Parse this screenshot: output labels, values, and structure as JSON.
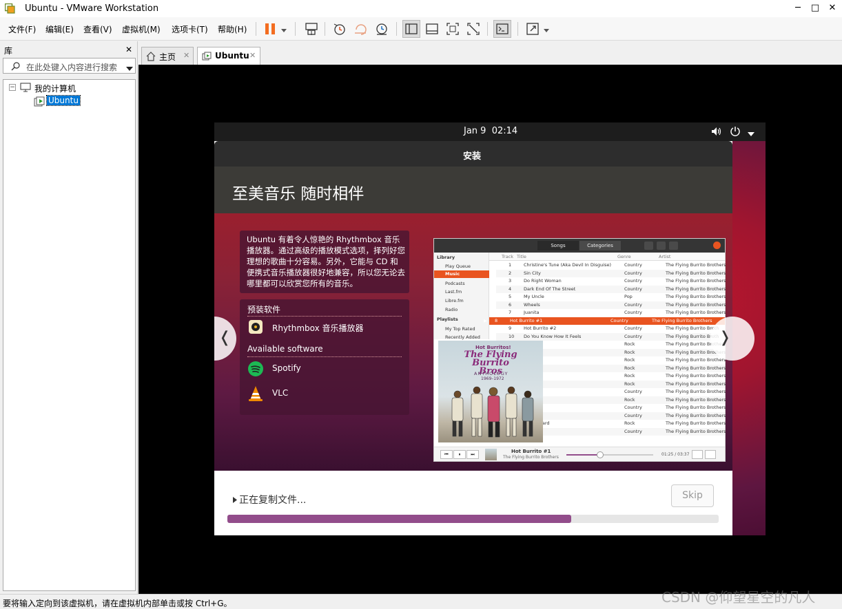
{
  "window": {
    "title": "Ubuntu - VMware Workstation",
    "minimize": "─",
    "maximize": "□",
    "close": "✕"
  },
  "menu": [
    "文件(F)",
    "编辑(E)",
    "查看(V)",
    "虚拟机(M)",
    "选项卡(T)",
    "帮助(H)"
  ],
  "library": {
    "title": "库",
    "close": "✕",
    "search_placeholder": "在此处键入内容进行搜索",
    "tree_root": "我的计算机",
    "tree_item": "Ubuntu",
    "expander": "−"
  },
  "tabs": [
    {
      "label": "主页",
      "close": "✕"
    },
    {
      "label": "Ubuntu",
      "close": "✕"
    }
  ],
  "ubuntu": {
    "clock_date": "Jan 9",
    "clock_time": "02:14",
    "installer_title": "安装",
    "headline": "至美音乐 随时相伴",
    "description": "Ubuntu 有着令人惊艳的 Rhythmbox 音乐播放器。通过高级的播放模式选项，择列好您理想的歌曲十分容易。另外，它能与 CD 和便携式音乐播放器很好地兼容，所以您无论去哪里都可以欣赏您所有的音乐。",
    "preinstalled_title": "预装软件",
    "preinstalled": [
      "Rhythmbox 音乐播放器"
    ],
    "available_title": "Available software",
    "available": [
      "Spotify",
      "VLC"
    ],
    "prev": "❬",
    "next": "❭",
    "progress_text": "正在复制文件...",
    "progress_fraction": 0.7,
    "skip": "Skip",
    "colors": {
      "accent": "#e95420",
      "progress": "#924d8b",
      "panel": "#1d1d1d"
    }
  },
  "rhythmbox": {
    "tab_songs": "Songs",
    "tab_categories": "Categories",
    "sidebar_library": "Library",
    "sidebar_items": [
      "Play Queue",
      "Music",
      "Podcasts",
      "Last.fm",
      "Libre.fm",
      "Radio"
    ],
    "sidebar_playlists": "Playlists",
    "playlist_items": [
      "My Top Rated",
      "Recently Added"
    ],
    "columns": [
      "Track",
      "Title",
      "Genre",
      "Artist"
    ],
    "rows": [
      {
        "n": "1",
        "title": "Christine's Tune (Aka Devil In Disguise)",
        "genre": "Country",
        "artist": "The Flying Burrito Brothers"
      },
      {
        "n": "2",
        "title": "Sin City",
        "genre": "Country",
        "artist": "The Flying Burrito Brothers"
      },
      {
        "n": "3",
        "title": "Do Right Woman",
        "genre": "Country",
        "artist": "The Flying Burrito Brothers"
      },
      {
        "n": "4",
        "title": "Dark End Of The Street",
        "genre": "Country",
        "artist": "The Flying Burrito Brothers"
      },
      {
        "n": "5",
        "title": "My Uncle",
        "genre": "Pop",
        "artist": "The Flying Burrito Brothers"
      },
      {
        "n": "6",
        "title": "Wheels",
        "genre": "Country",
        "artist": "The Flying Burrito Brothers"
      },
      {
        "n": "7",
        "title": "Juanita",
        "genre": "Country",
        "artist": "The Flying Burrito Brothers"
      },
      {
        "n": "8",
        "title": "Hot Burrito #1",
        "genre": "Country",
        "artist": "The Flying Burrito Brothers"
      },
      {
        "n": "9",
        "title": "Hot Burrito #2",
        "genre": "Country",
        "artist": "The Flying Burrito Broth"
      },
      {
        "n": "10",
        "title": "Do You Know How It Feels",
        "genre": "Country",
        "artist": "The Flying Burrito Broth"
      },
      {
        "n": "",
        "title": "ong",
        "genre": "Rock",
        "artist": "The Flying Burrito Brothers"
      },
      {
        "n": "",
        "title": "",
        "genre": "Rock",
        "artist": "The Flying Burrito Brothers"
      },
      {
        "n": "",
        "title": "",
        "genre": "Rock",
        "artist": "The Flying Burrito Brothers"
      },
      {
        "n": "",
        "title": "n Queen",
        "genre": "Rock",
        "artist": "The Flying Burrito Brothers"
      },
      {
        "n": "",
        "title": "Go",
        "genre": "Rock",
        "artist": "The Flying Burrito Brothers"
      },
      {
        "n": "",
        "title": "Fog",
        "genre": "Rock",
        "artist": "The Flying Burrito Brothers"
      },
      {
        "n": "",
        "title": "ng",
        "genre": "Country",
        "artist": "The Flying Burrito Brothers"
      },
      {
        "n": "",
        "title": "",
        "genre": "Rock",
        "artist": "The Flying Burrito Brothers"
      },
      {
        "n": "",
        "title": "",
        "genre": "Country",
        "artist": "The Flying Burrito Brothers"
      },
      {
        "n": "",
        "title": "Singer",
        "genre": "Country",
        "artist": "The Flying Burrito Brothers"
      },
      {
        "n": "",
        "title": "Churchyard",
        "genre": "Rock",
        "artist": "The Flying Burrito Brothers"
      },
      {
        "n": "",
        "title": "",
        "genre": "Country",
        "artist": "The Flying Burrito Brothers"
      }
    ],
    "album_top": "Hot Burritos!",
    "album_main": "The Flying Burrito Bros",
    "album_sub": "ANTHOLOGY",
    "album_years": "1969–1972",
    "now_title": "Hot Burrito #1",
    "now_artist": "The Flying Burrito Brothers",
    "time": "01:25 / 03:37"
  },
  "statusbar": {
    "text": "要将输入定向到该虚拟机，请在虚拟机内部单击或按 Ctrl+G。",
    "watermark": "CSDN @仰望星空的凡人"
  }
}
